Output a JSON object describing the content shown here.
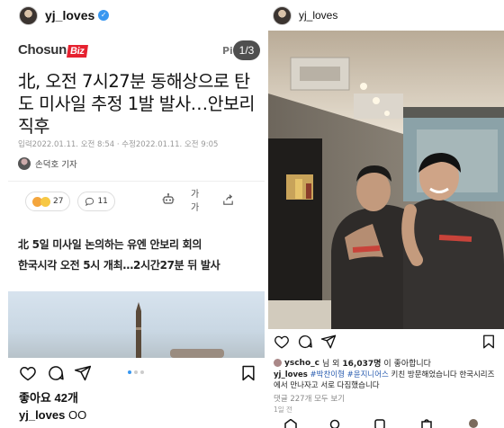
{
  "left_post": {
    "username": "yj_loves",
    "article": {
      "publisher_name": "Chosun",
      "publisher_badge": "Biz",
      "pi_text": "Pi",
      "page_indicator": "1/3",
      "headline": "北, 오전 7시27분 동해상으로 탄도 미사일 추정 1발 발사…안보리 직후",
      "dateline": "입력2022.01.11. 오전 8:54 · 수정2022.01.11. 오전 9:05",
      "reporter": "손덕호 기자",
      "reaction_count": "27",
      "comment_count": "11",
      "font_size_label": "가가",
      "subhead_line1": "北 5일 미사일 논의하는 유엔 안보리 회의",
      "subhead_line2": "한국시각 오전 5시 개최…2시간27분 뒤 발사"
    },
    "carousel": {
      "total": 3,
      "active": 0
    },
    "likes": "좋아요 42개",
    "caption_user": "yj_loves",
    "caption_text": "OO"
  },
  "right_post": {
    "username": "yj_loves",
    "liked_by_user": "yscho_c",
    "liked_by_mid": "님 외",
    "liked_by_count": "16,037명",
    "liked_by_suffix": "이 좋아합니다",
    "caption_user": "yj_loves",
    "caption_tags": "#박찬이형 #윤지니어스",
    "caption_text": " 키친 방문해었습니다 한국시리즈에서 만나자고 서로 다짐했습니다",
    "comments_link": "댓글 227개 모두 보기",
    "time_ago": "1일 전"
  },
  "colors": {
    "accent": "#3897f0",
    "chosun_red": "#e6212f",
    "tag_blue": "#2a5db0"
  }
}
